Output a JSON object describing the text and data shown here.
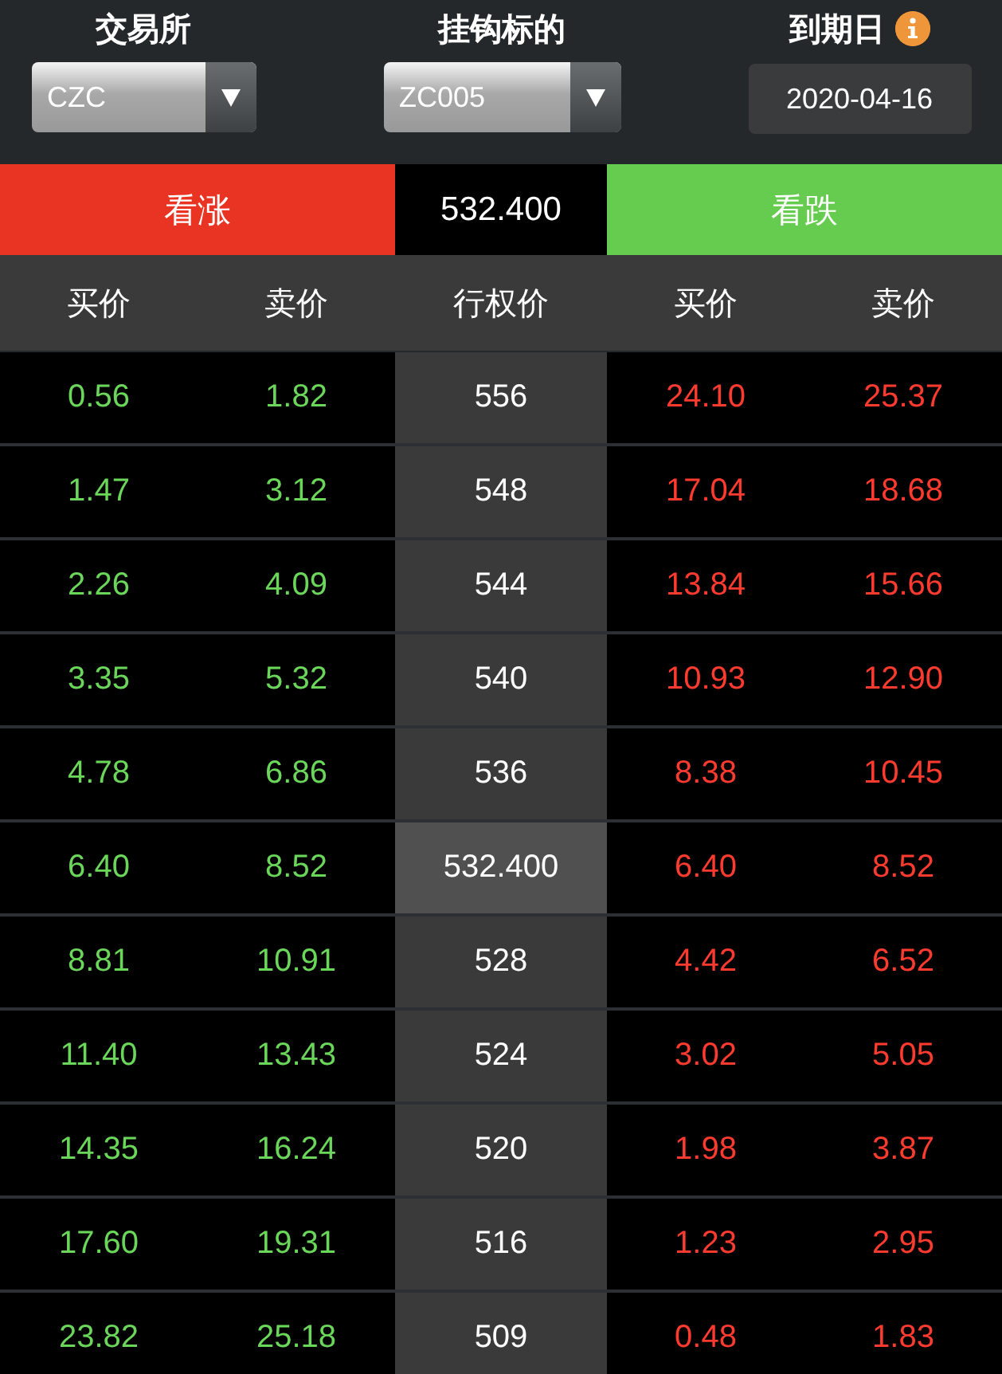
{
  "filters": [
    {
      "kind": "select",
      "label": "交易所",
      "value": "CZC"
    },
    {
      "kind": "select",
      "label": "挂钩标的",
      "value": "ZC005"
    },
    {
      "kind": "date",
      "label": "到期日",
      "value": "2020-04-16",
      "info": true
    }
  ],
  "sides": {
    "call": "看涨",
    "price": "532.400",
    "put": "看跌"
  },
  "columns": [
    "买价",
    "卖价",
    "行权价",
    "买价",
    "卖价"
  ],
  "rows": [
    {
      "call_bid": "0.56",
      "call_ask": "1.82",
      "strike": "556",
      "put_bid": "24.10",
      "put_ask": "25.37",
      "highlighted": false
    },
    {
      "call_bid": "1.47",
      "call_ask": "3.12",
      "strike": "548",
      "put_bid": "17.04",
      "put_ask": "18.68",
      "highlighted": false
    },
    {
      "call_bid": "2.26",
      "call_ask": "4.09",
      "strike": "544",
      "put_bid": "13.84",
      "put_ask": "15.66",
      "highlighted": false
    },
    {
      "call_bid": "3.35",
      "call_ask": "5.32",
      "strike": "540",
      "put_bid": "10.93",
      "put_ask": "12.90",
      "highlighted": false
    },
    {
      "call_bid": "4.78",
      "call_ask": "6.86",
      "strike": "536",
      "put_bid": "8.38",
      "put_ask": "10.45",
      "highlighted": false
    },
    {
      "call_bid": "6.40",
      "call_ask": "8.52",
      "strike": "532.400",
      "put_bid": "6.40",
      "put_ask": "8.52",
      "highlighted": true
    },
    {
      "call_bid": "8.81",
      "call_ask": "10.91",
      "strike": "528",
      "put_bid": "4.42",
      "put_ask": "6.52",
      "highlighted": false
    },
    {
      "call_bid": "11.40",
      "call_ask": "13.43",
      "strike": "524",
      "put_bid": "3.02",
      "put_ask": "5.05",
      "highlighted": false
    },
    {
      "call_bid": "14.35",
      "call_ask": "16.24",
      "strike": "520",
      "put_bid": "1.98",
      "put_ask": "3.87",
      "highlighted": false
    },
    {
      "call_bid": "17.60",
      "call_ask": "19.31",
      "strike": "516",
      "put_bid": "1.23",
      "put_ask": "2.95",
      "highlighted": false
    },
    {
      "call_bid": "23.82",
      "call_ask": "25.18",
      "strike": "509",
      "put_bid": "0.48",
      "put_ask": "1.83",
      "highlighted": false
    }
  ]
}
